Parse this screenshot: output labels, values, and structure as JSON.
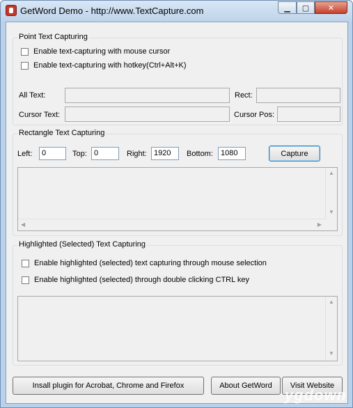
{
  "window": {
    "title": "GetWord Demo - http://www.TextCapture.com",
    "controls": {
      "minimize": "▁",
      "maximize": "▢",
      "close": "✕"
    }
  },
  "point_capture": {
    "group_label": "Point Text Capturing",
    "check_mouse": "Enable text-capturing with mouse cursor",
    "check_hotkey": "Enable text-capturing with hotkey(Ctrl+Alt+K)",
    "all_text_label": "All Text:",
    "rect_label": "Rect:",
    "cursor_text_label": "Cursor Text:",
    "cursor_pos_label": "Cursor Pos:",
    "all_text_value": "",
    "rect_value": "",
    "cursor_text_value": "",
    "cursor_pos_value": ""
  },
  "rect_capture": {
    "group_label": "Rectangle Text Capturing",
    "left_label": "Left:",
    "top_label": "Top:",
    "right_label": "Right:",
    "bottom_label": "Bottom:",
    "left_value": "0",
    "top_value": "0",
    "right_value": "1920",
    "bottom_value": "1080",
    "capture_button": "Capture"
  },
  "highlight_capture": {
    "group_label": "Highlighted (Selected) Text Capturing",
    "check_mouse_selection": "Enable highlighted (selected) text capturing through mouse selection",
    "check_ctrl": "Enable highlighted (selected) through double clicking CTRL key"
  },
  "footer": {
    "install_button": "Insall plugin for Acrobat, Chrome and Firefox",
    "about_button": "About GetWord",
    "visit_button": "Visit Website"
  },
  "watermark": "ygdown"
}
